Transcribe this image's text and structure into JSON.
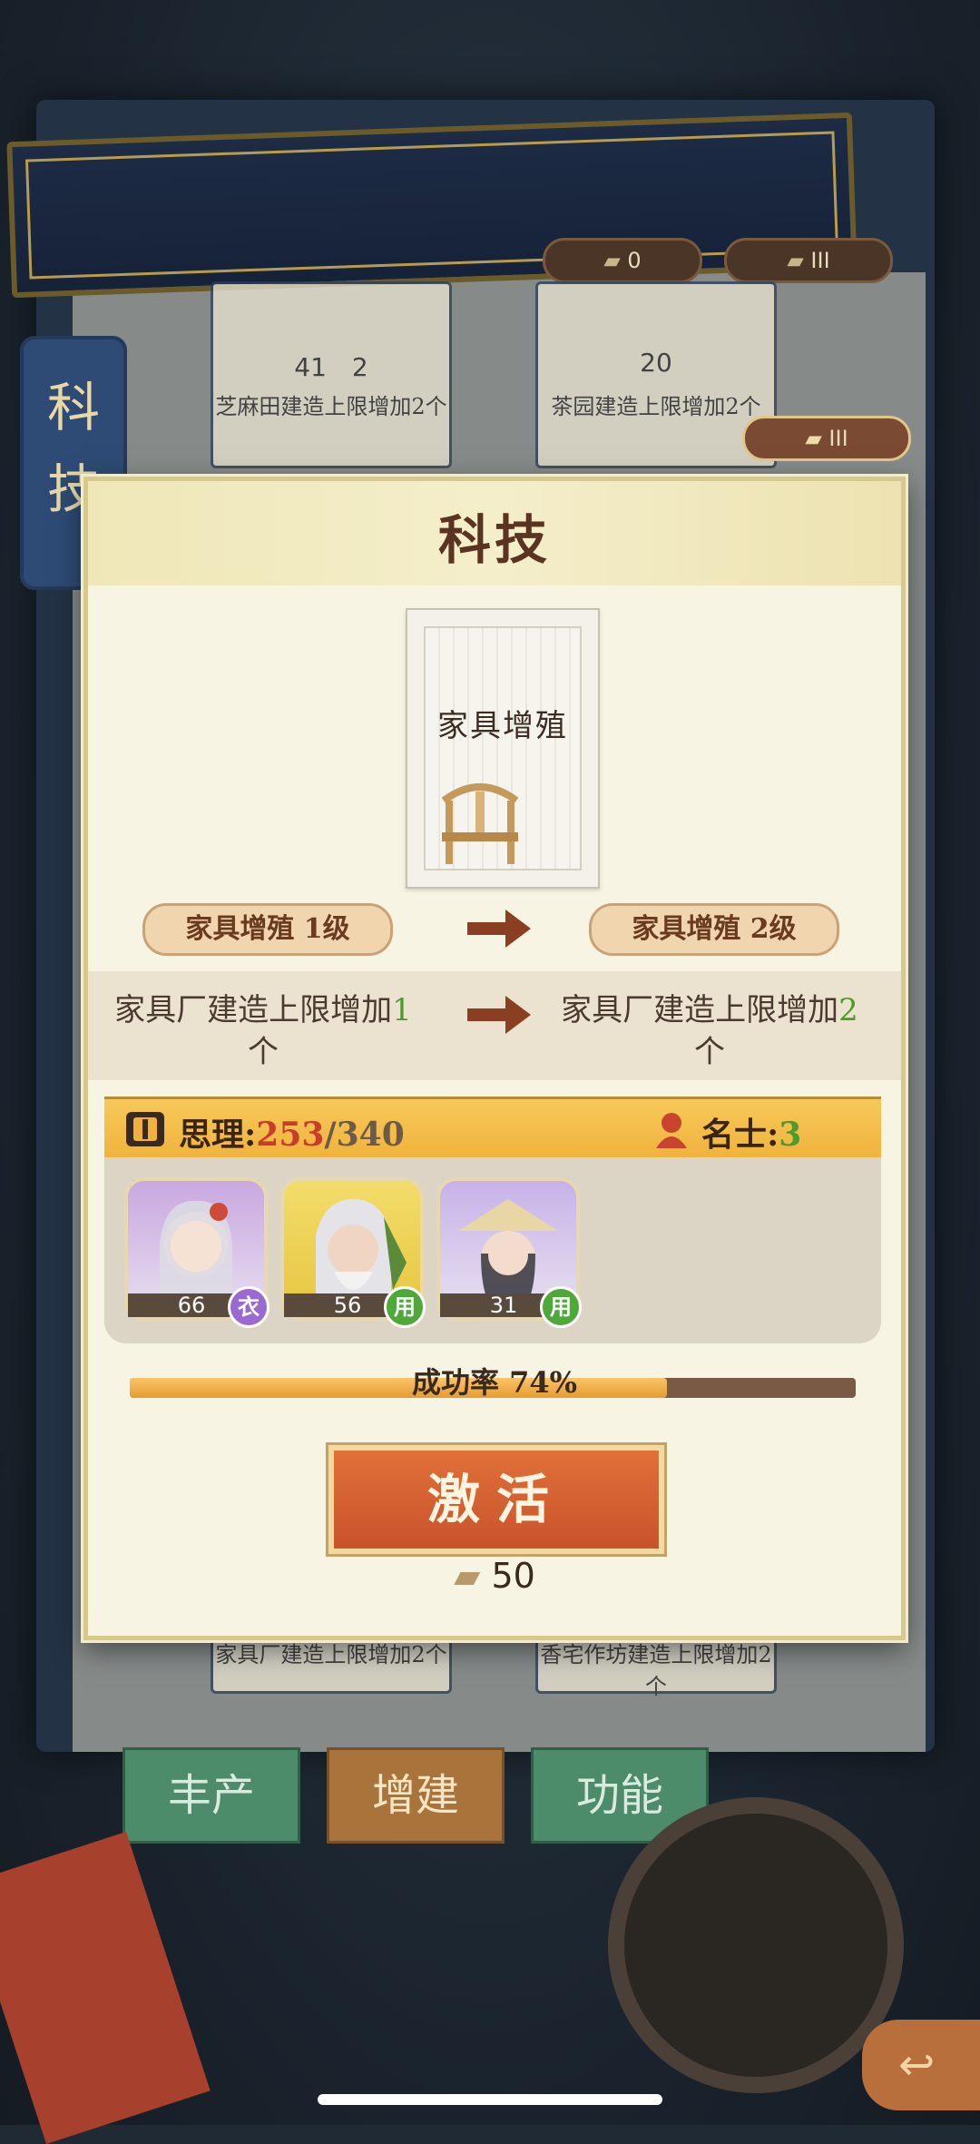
{
  "resources": {
    "top_left": "0",
    "top_right": "III",
    "floating": "III"
  },
  "side_tab": "科技",
  "background_cards": [
    {
      "cost": "41",
      "cost2": "2",
      "caption": "芝麻田建造上限增加2个"
    },
    {
      "cost": "20",
      "caption": "茶园建造上限增加2个"
    },
    {
      "caption": "家具厂建造上限增加2个"
    },
    {
      "caption": "香宅作坊建造上限增加2个"
    }
  ],
  "bottom_tabs": [
    "丰产",
    "增建",
    "功能"
  ],
  "modal": {
    "title": "科技",
    "card_name": "家具增殖",
    "level_from": "家具增殖 1级",
    "level_to": "家具增殖 2级",
    "effect_from_prefix": "家具厂建造上限增加",
    "effect_from_num": "1",
    "effect_from_suffix": "个",
    "effect_to_prefix": "家具厂建造上限增加",
    "effect_to_num": "2",
    "effect_to_suffix": "个",
    "sili_label": "思理:",
    "sili_current": "253",
    "sili_total": "/340",
    "mingshi_label": "名士:",
    "mingshi_value": "3",
    "heroes": [
      {
        "level": "66",
        "badge": "衣",
        "badge_color": "#9a6ad0"
      },
      {
        "level": "56",
        "badge": "用",
        "badge_color": "#4ea83a"
      },
      {
        "level": "31",
        "badge": "用",
        "badge_color": "#4ea83a"
      }
    ],
    "success_rate_label": "成功率 74%",
    "success_rate": 0.74,
    "activate_label": "激活",
    "activate_cost": "50"
  },
  "colors": {
    "accent": "#c9532a",
    "panel": "#f7f4e3"
  }
}
